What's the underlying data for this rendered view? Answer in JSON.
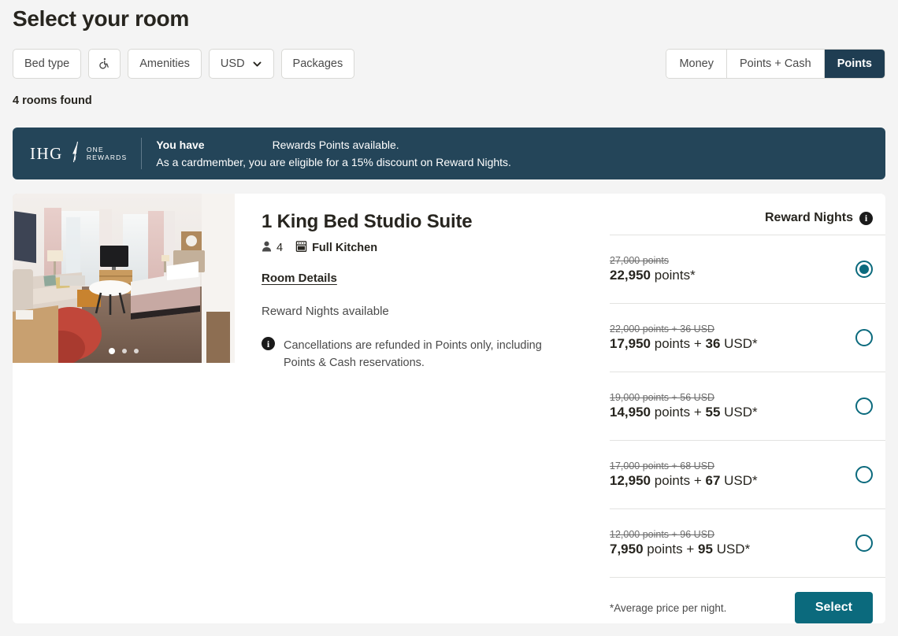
{
  "header": {
    "title": "Select your room",
    "rooms_found": "4 rooms found"
  },
  "filters": [
    {
      "label": "Bed type",
      "icon": null,
      "type": "chip"
    },
    {
      "label": "",
      "icon": "wheelchair-accessible-icon",
      "type": "icon"
    },
    {
      "label": "Amenities",
      "icon": null,
      "type": "chip"
    },
    {
      "label": "USD",
      "icon": "chevron-down-icon",
      "type": "select"
    },
    {
      "label": "Packages",
      "icon": null,
      "type": "chip"
    }
  ],
  "currency_options": [
    "USD"
  ],
  "payment_toggle": {
    "options": [
      {
        "label": "Money",
        "active": false
      },
      {
        "label": "Points + Cash",
        "active": false
      },
      {
        "label": "Points",
        "active": true
      }
    ]
  },
  "banner": {
    "brand_word": "IHG",
    "brand_sub_line1": "ONE",
    "brand_sub_line2": "REWARDS",
    "line1_prefix": "You have",
    "line1_suffix": "Rewards Points available.",
    "line2": "As a cardmember, you are eligible for a 15% discount on Reward Nights.",
    "background": "#244559"
  },
  "room": {
    "name": "1 King Bed Studio Suite",
    "occupancy": "4",
    "amenity": "Full Kitchen",
    "details_link": "Room Details",
    "reward_available": "Reward Nights available",
    "cancellation_note": "Cancellations are refunded in Points only, including Points & Cash reservations.",
    "carousel_dots": 3,
    "carousel_active": 0
  },
  "rates": {
    "heading": "Reward Nights",
    "footnote": "*Average price per night.",
    "select_label": "Select",
    "accent_color": "#0b6a7d",
    "rows": [
      {
        "old": "27,000 points",
        "amount": "22,950",
        "unit": "points*",
        "extra": "",
        "extra_unit": "",
        "selected": true
      },
      {
        "old": "22,000 points + 36 USD",
        "amount": "17,950",
        "unit": "points",
        "extra": "36",
        "extra_unit": "USD*",
        "selected": false
      },
      {
        "old": "19,000 points + 56 USD",
        "amount": "14,950",
        "unit": "points",
        "extra": "55",
        "extra_unit": "USD*",
        "selected": false
      },
      {
        "old": "17,000 points + 68 USD",
        "amount": "12,950",
        "unit": "points",
        "extra": "67",
        "extra_unit": "USD*",
        "selected": false
      },
      {
        "old": "12,000 points + 96 USD",
        "amount": "7,950",
        "unit": "points",
        "extra": "95",
        "extra_unit": "USD*",
        "selected": false
      }
    ]
  }
}
